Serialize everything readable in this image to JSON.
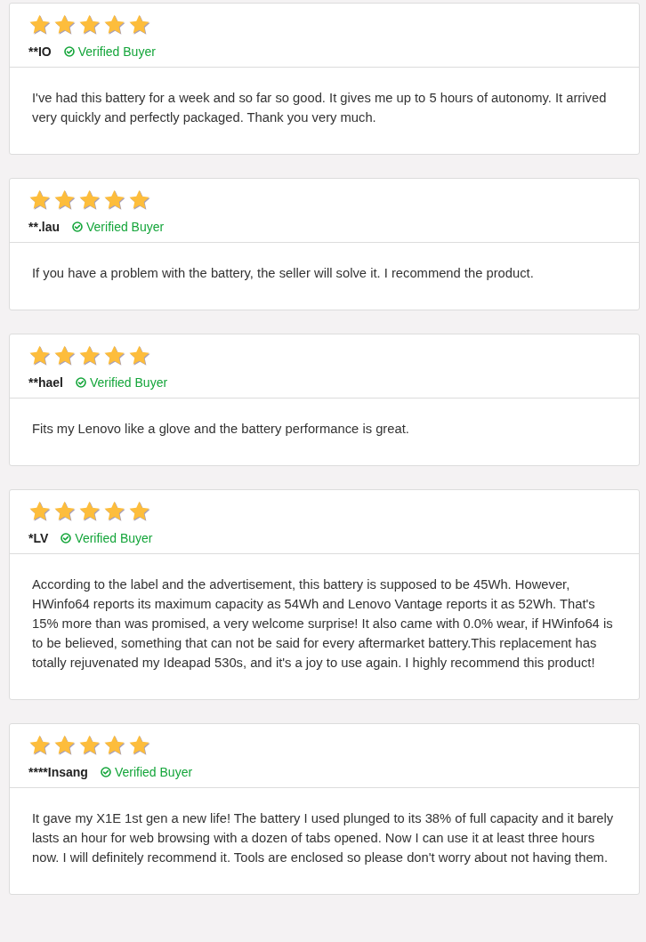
{
  "reviews": [
    {
      "stars": 5,
      "author": "**IO",
      "badge": "Verified Buyer",
      "text": "I've had this battery for a week and so far so good. It gives me up to 5 hours of autonomy. It arrived very quickly and perfectly packaged. Thank you very much."
    },
    {
      "stars": 5,
      "author": "**.lau",
      "badge": "Verified Buyer",
      "text": "If you have a problem with the battery, the seller will solve it. I recommend the product."
    },
    {
      "stars": 5,
      "author": "**hael",
      "badge": "Verified Buyer",
      "text": "Fits my Lenovo like a glove and the battery performance is great."
    },
    {
      "stars": 5,
      "author": "*LV",
      "badge": "Verified Buyer",
      "text": "According to the label and the advertisement, this battery is supposed to be 45Wh. However, HWinfo64 reports its maximum capacity as 54Wh and Lenovo Vantage reports it as 52Wh. That's 15% more than was promised, a very welcome surprise! It also came with 0.0% wear, if HWinfo64 is to be believed, something that can not be said for every aftermarket battery.This replacement has totally rejuvenated my Ideapad 530s, and it's a joy to use again. I highly recommend this product!"
    },
    {
      "stars": 5,
      "author": "****Insang",
      "badge": "Verified Buyer",
      "text": "It gave my X1E 1st gen a new life! The battery I used plunged to its 38% of full capacity and it barely lasts an hour for web browsing with a dozen of tabs opened. Now I can use it at least three hours now. I will definitely recommend it. Tools are enclosed so please don't worry about not having them."
    }
  ]
}
